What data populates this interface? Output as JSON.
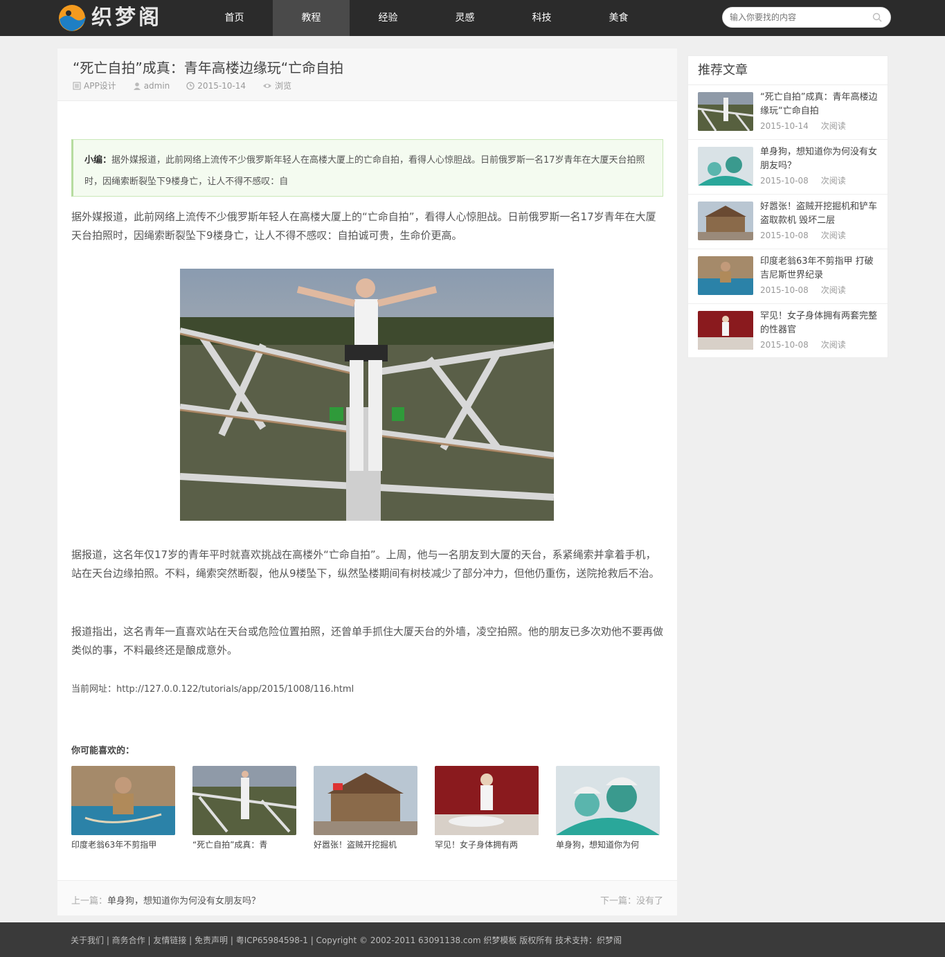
{
  "header": {
    "logo_text": "织梦阁",
    "nav": [
      "首页",
      "教程",
      "经验",
      "灵感",
      "科技",
      "美食"
    ],
    "active_nav": 1,
    "search_placeholder": "输入你要找的内容",
    "search_icon": "search-icon"
  },
  "article": {
    "title": "“死亡自拍”成真：青年高楼边缘玩“亡命自拍",
    "category": "APP设计",
    "author": "admin",
    "date": "2015-10-14",
    "views_label": "浏览",
    "summary_label": "小编：",
    "summary_text": "据外媒报道，此前网络上流传不少俄罗斯年轻人在高楼大厦上的亡命自拍，看得人心惊胆战。日前俄罗斯一名17岁青年在大厦天台拍照时，因绳索断裂坠下9楼身亡，让人不得不感叹：自",
    "paragraph1": "据外媒报道，此前网络上流传不少俄罗斯年轻人在高楼大厦上的“亡命自拍”，看得人心惊胆战。日前俄罗斯一名17岁青年在大厦天台拍照时，因绳索断裂坠下9楼身亡，让人不得不感叹：自拍诚可贵，生命价更高。",
    "paragraph2": "据报道，这名年仅17岁的青年平时就喜欢挑战在高楼外“亡命自拍”。上周，他与一名朋友到大厦的天台，系紧绳索并拿着手机，站在天台边缘拍照。不料，绳索突然断裂，他从9楼坠下，纵然坠楼期间有树枝减少了部分冲力，但他仍重伤，送院抢救后不治。",
    "paragraph3": "报道指出，这名青年一直喜欢站在天台或危险位置拍照，还曾单手抓住大厦天台的外墙，凌空拍照。他的朋友已多次劝他不要再做类似的事，不料最终还是酿成意外。",
    "url_label": "当前网址：",
    "url": "http://127.0.0.122/tutorials/app/2015/1008/116.html"
  },
  "related": {
    "title": "你可能喜欢的：",
    "items": [
      "印度老翁63年不剪指甲",
      "“死亡自拍”成真：青",
      "好嚣张！盗贼开挖掘机",
      "罕见！女子身体拥有两",
      "单身狗，想知道你为何"
    ]
  },
  "pager": {
    "prev_label": "上一篇：",
    "prev_title": "单身狗，想知道你为何没有女朋友吗？",
    "next_label": "下一篇：",
    "next_title": "没有了"
  },
  "sidebar": {
    "title": "推荐文章",
    "items": [
      {
        "title": "“死亡自拍”成真：青年高楼边缘玩“亡命自拍",
        "date": "2015-10-14",
        "views": "次阅读"
      },
      {
        "title": "单身狗，想知道你为何没有女朋友吗？",
        "date": "2015-10-08",
        "views": "次阅读"
      },
      {
        "title": "好嚣张！盗贼开挖掘机和铲车盗取款机 毁坏二层",
        "date": "2015-10-08",
        "views": "次阅读"
      },
      {
        "title": "印度老翁63年不剪指甲 打破吉尼斯世界纪录",
        "date": "2015-10-08",
        "views": "次阅读"
      },
      {
        "title": "罕见！女子身体拥有两套完整的性器官",
        "date": "2015-10-08",
        "views": "次阅读"
      }
    ]
  },
  "footer": {
    "text": "关于我们 | 商务合作 | 友情链接 | 免责声明 | 粤ICP65984598-1 | Copyright © 2002-2011 63091138.com 织梦模板 版权所有 技术支持：织梦阁"
  },
  "colors": {
    "topbar": "#2b2b2b",
    "nav_active": "#4a4a4a",
    "summary_bg": "#f4fbf0",
    "summary_border": "#c9e8b8",
    "footer": "#3a3a3a"
  }
}
